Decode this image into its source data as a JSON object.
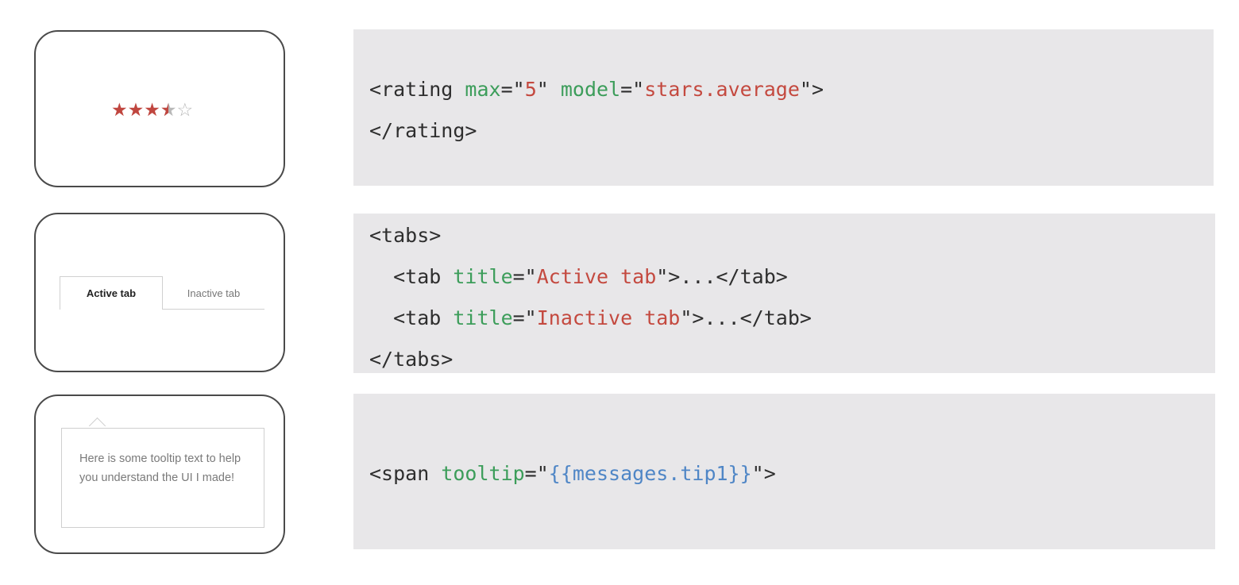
{
  "rating_example": {
    "stars": {
      "max": 5,
      "value": 3.5
    },
    "code": {
      "l1_tag_open": "<rating ",
      "l1_attr1": "max",
      "l1_eq1": "=\"",
      "l1_val1": "5",
      "l1_q1": "\" ",
      "l1_attr2": "model",
      "l1_eq2": "=\"",
      "l1_val2": "stars.average",
      "l1_end": "\">",
      "l2": "</rating>"
    }
  },
  "tabs_example": {
    "active_tab": "Active tab",
    "inactive_tab": "Inactive tab",
    "code": {
      "l1": "<tabs>",
      "l2_tag": "  <tab ",
      "l2_attr": "title",
      "l2_eq": "=\"",
      "l2_val": "Active tab",
      "l2_end": "\">...</tab>",
      "l3_tag": "  <tab ",
      "l3_attr": "title",
      "l3_eq": "=\"",
      "l3_val": "Inactive tab",
      "l3_end": "\">...</tab>",
      "l4": "</tabs>"
    }
  },
  "tooltip_example": {
    "text": "Here is some tooltip text to help you understand the UI I made!",
    "code": {
      "l1_tag": "<span ",
      "l1_attr": "tooltip",
      "l1_eq": "=\"",
      "l1_val": "{{messages.tip1}}",
      "l1_end": "\">"
    }
  },
  "colors": {
    "star": "#c0463f",
    "code_attr": "#3c9d5a",
    "code_string": "#c4493f",
    "code_expression": "#4f86c6",
    "code_background": "#e8e7e9"
  }
}
